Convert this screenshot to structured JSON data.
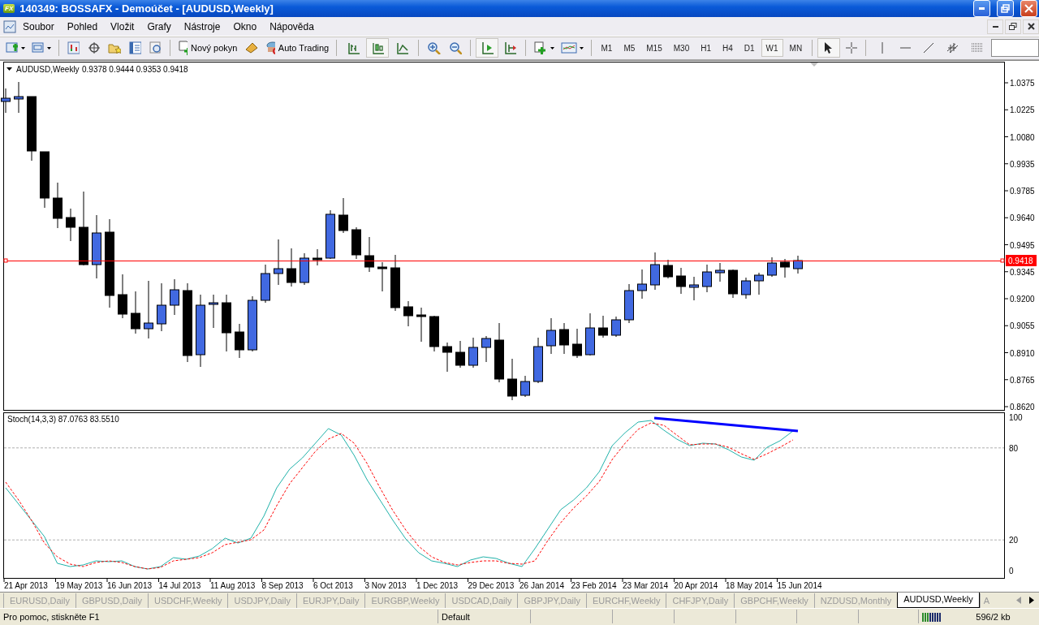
{
  "window": {
    "logo": "FX",
    "title": "140349: BOSSAFX - Demoúčet - [AUDUSD,Weekly]"
  },
  "menu": [
    "Soubor",
    "Pohled",
    "Vložit",
    "Grafy",
    "Nástroje",
    "Okno",
    "Nápověda"
  ],
  "toolbar": {
    "new_order": "Nový pokyn",
    "auto_trading": "Auto Trading",
    "chart_types": [
      {
        "kind": "bars",
        "selected": false
      },
      {
        "kind": "candles",
        "selected": true
      },
      {
        "kind": "line",
        "selected": false
      }
    ],
    "autoscroll": true,
    "timeframes": [
      {
        "label": "M1",
        "selected": false
      },
      {
        "label": "M5",
        "selected": false
      },
      {
        "label": "M15",
        "selected": false
      },
      {
        "label": "M30",
        "selected": false
      },
      {
        "label": "H1",
        "selected": false
      },
      {
        "label": "H4",
        "selected": false
      },
      {
        "label": "D1",
        "selected": false
      },
      {
        "label": "W1",
        "selected": true
      },
      {
        "label": "MN",
        "selected": false
      }
    ],
    "cursor_selected": true
  },
  "chart": {
    "symbol": "AUDUSD,Weekly",
    "ohlc": "0.9378 0.9444 0.9353 0.9418",
    "price_labels": [
      "1.0375",
      "1.0225",
      "1.0080",
      "0.9935",
      "0.9785",
      "0.9640",
      "0.9495",
      "0.9345",
      "0.9200",
      "0.9055",
      "0.8910",
      "0.8765",
      "0.8620"
    ],
    "current_price": "0.9418",
    "indicator": {
      "label": "Stoch(14,3,3) 87.0763 83.5510",
      "levels": [
        "100",
        "80",
        "20",
        "0"
      ]
    },
    "dates": [
      "21 Apr 2013",
      "19 May 2013",
      "16 Jun 2013",
      "14 Jul 2013",
      "11 Aug 2013",
      "8 Sep 2013",
      "6 Oct 2013",
      "3 Nov 2013",
      "1 Dec 2013",
      "29 Dec 2013",
      "26 Jan 2014",
      "23 Feb 2014",
      "23 Mar 2014",
      "20 Apr 2014",
      "18 May 2014",
      "15 Jun 2014"
    ]
  },
  "tabs": [
    {
      "label": "EURUSD,Daily",
      "selected": false
    },
    {
      "label": "GBPUSD,Daily",
      "selected": false
    },
    {
      "label": "USDCHF,Weekly",
      "selected": false
    },
    {
      "label": "USDJPY,Daily",
      "selected": false
    },
    {
      "label": "EURJPY,Daily",
      "selected": false
    },
    {
      "label": "EURGBP,Weekly",
      "selected": false
    },
    {
      "label": "USDCAD,Daily",
      "selected": false
    },
    {
      "label": "GBPJPY,Daily",
      "selected": false
    },
    {
      "label": "EURCHF,Weekly",
      "selected": false
    },
    {
      "label": "CHFJPY,Daily",
      "selected": false
    },
    {
      "label": "GBPCHF,Weekly",
      "selected": false
    },
    {
      "label": "NZDUSD,Monthly",
      "selected": false
    },
    {
      "label": "AUDUSD,Weekly",
      "selected": true
    },
    {
      "label": "A",
      "selected": false
    }
  ],
  "status_bar": {
    "help": "Pro pomoc, stiskněte F1",
    "profile": "Default",
    "traffic": "596/2 kb"
  }
}
